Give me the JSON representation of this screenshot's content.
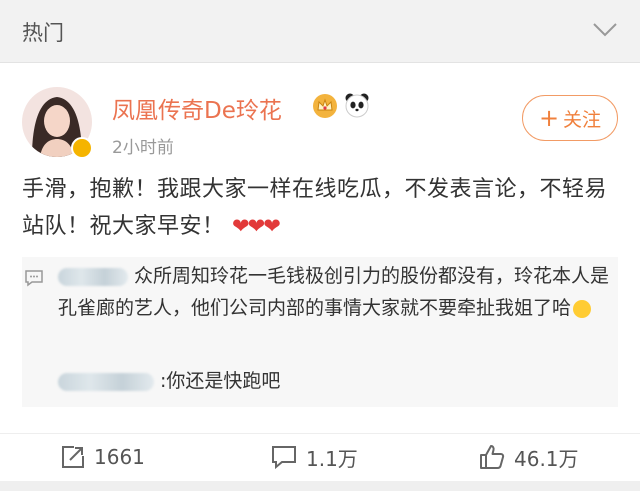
{
  "section": {
    "title": "热门"
  },
  "post": {
    "author": "凤凰传奇De玲花",
    "time": "2小时前",
    "follow_label": "关注",
    "follow_plus": "+",
    "text": "手滑，抱歉！我跟大家一样在线吃瓜，不发表言论，不轻易站队！祝大家早安！",
    "hearts": "❤❤❤"
  },
  "comments": [
    {
      "text": "众所周知玲花一毛钱极创引力的股份都没有，玲花本人是孔雀廊的艺人，他们公司内部的事情大家就不要牵扯我姐了哈"
    },
    {
      "text": ":你还是快跑吧"
    }
  ],
  "actions": {
    "repost_count": "1661",
    "comment_count": "1.1万",
    "like_count": "46.1万"
  },
  "colors": {
    "author": "#eb7350",
    "follow": "#f0803c",
    "heart": "#e23a3a",
    "verified": "#f5b400"
  }
}
